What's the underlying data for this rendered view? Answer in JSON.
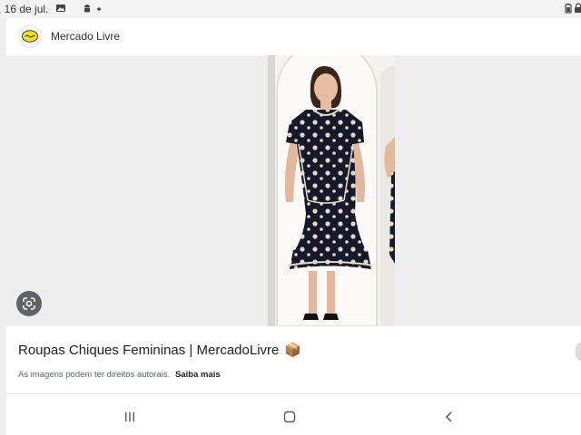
{
  "status_bar": {
    "time": ", 16 de jul.",
    "icons": [
      "gallery-icon",
      "android-icon",
      "dot-icon",
      "battery-icon",
      "lock-icon"
    ]
  },
  "source": {
    "name": "Mercado Livre",
    "favicon": "mercadolivre-handshake-logo"
  },
  "result": {
    "title": "Roupas Chiques Femininas | MercadoLivre",
    "title_emoji": "📦",
    "copyright_text": "As imagens podem ter direitos autorais.",
    "more_link": "Saiba mais"
  },
  "controls": {
    "lens_icon": "google-lens-icon"
  },
  "nav": {
    "recents_icon": "recents-icon",
    "home_icon": "home-icon",
    "back_icon": "back-icon"
  },
  "colors": {
    "dress": "#15192b",
    "polka_dots": "#e8d8c4",
    "brand_yellow": "#ffe600"
  }
}
